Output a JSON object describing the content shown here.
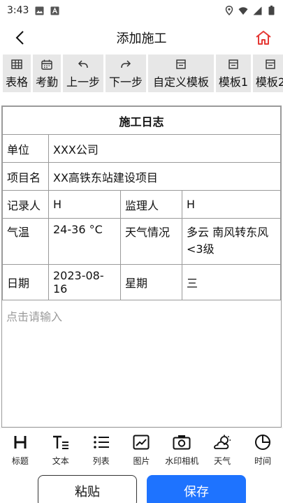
{
  "status_bar": {
    "time": "3:43"
  },
  "header": {
    "title": "添加施工"
  },
  "toolbar": {
    "items": [
      {
        "label": "表格",
        "icon": "table-icon"
      },
      {
        "label": "考勤",
        "icon": "calendar-icon"
      },
      {
        "label": "上一步",
        "icon": "undo-icon"
      },
      {
        "label": "下一步",
        "icon": "redo-icon"
      },
      {
        "label": "自定义模板",
        "icon": "template-icon"
      },
      {
        "label": "模板1",
        "icon": "template-icon"
      },
      {
        "label": "模板2",
        "icon": "template-icon"
      }
    ]
  },
  "log": {
    "title": "施工日志",
    "unit_label": "单位",
    "unit_value": "XXX公司",
    "project_label": "项目名",
    "project_value": "XX高铁东站建设项目",
    "recorder_label": "记录人",
    "recorder_value": "H",
    "supervisor_label": "监理人",
    "supervisor_value": "H",
    "temp_label": "气温",
    "temp_value": "24-36 °C",
    "weather_label": "天气情况",
    "weather_value": "多云 南风转东风<3级",
    "date_label": "日期",
    "date_value": "2023-08-16",
    "weekday_label": "星期",
    "weekday_value": "三",
    "placeholder": "点击请输入"
  },
  "format_bar": {
    "items": [
      {
        "label": "标题",
        "icon": "heading-icon"
      },
      {
        "label": "文本",
        "icon": "text-icon"
      },
      {
        "label": "列表",
        "icon": "list-icon"
      },
      {
        "label": "图片",
        "icon": "image-icon"
      },
      {
        "label": "水印相机",
        "icon": "camera-icon"
      },
      {
        "label": "天气",
        "icon": "weather-icon"
      },
      {
        "label": "时间",
        "icon": "clock-icon"
      }
    ]
  },
  "actions": {
    "paste": "粘贴",
    "save": "保存"
  },
  "colors": {
    "accent": "#1e73ff",
    "home_icon": "#e53935",
    "toolbar_bg": "#e7e7e7"
  }
}
